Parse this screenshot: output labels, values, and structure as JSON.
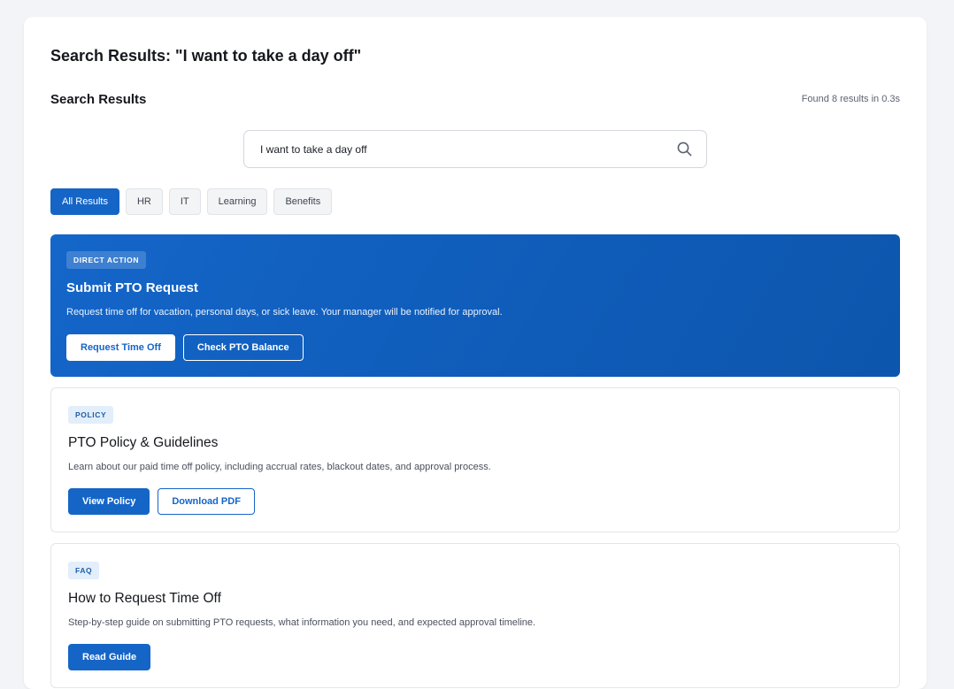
{
  "page": {
    "title": "Search Results: \"I want to take a day off\""
  },
  "results_header": {
    "title": "Search Results",
    "count_text": "Found 8 results in 0.3s"
  },
  "search": {
    "value": "I want to take a day off",
    "icon": "search-icon"
  },
  "tabs": [
    {
      "label": "All Results",
      "active": true
    },
    {
      "label": "HR",
      "active": false
    },
    {
      "label": "IT",
      "active": false
    },
    {
      "label": "Learning",
      "active": false
    },
    {
      "label": "Benefits",
      "active": false
    }
  ],
  "results": [
    {
      "badge": "DIRECT ACTION",
      "title": "Submit PTO Request",
      "description": "Request time off for vacation, personal days, or sick leave. Your manager will be notified for approval.",
      "primary_action": "Request Time Off",
      "secondary_action": "Check PTO Balance"
    },
    {
      "badge": "POLICY",
      "title": "PTO Policy & Guidelines",
      "description": "Learn about our paid time off policy, including accrual rates, blackout dates, and approval process.",
      "primary_action": "View Policy",
      "secondary_action": "Download PDF"
    },
    {
      "badge": "FAQ",
      "title": "How to Request Time Off",
      "description": "Step-by-step guide on submitting PTO requests, what information you need, and expected approval timeline.",
      "primary_action": "Read Guide"
    }
  ],
  "colors": {
    "accent": "#1565c7",
    "background": "#f3f4f7",
    "badge_bg": "#e3eefb"
  }
}
